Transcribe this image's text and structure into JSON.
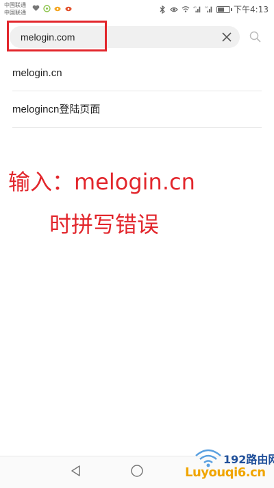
{
  "status_bar": {
    "carrier_1": "中国联通",
    "carrier_2": "中国联通",
    "signal_1_label": "4G",
    "signal_2_label": "2G",
    "time": "下午4:13"
  },
  "search": {
    "value": "melogin.com",
    "clear_icon": "close-icon",
    "search_icon": "search-icon"
  },
  "suggestions": [
    {
      "label": "melogin.cn"
    },
    {
      "label": "melogincn登陆页面"
    }
  ],
  "annotation": {
    "line1": "输入：melogin.cn",
    "line2": "时拼写错误",
    "color": "#e2262c"
  },
  "nav": {
    "back_icon": "back-triangle-icon",
    "home_icon": "home-circle-icon"
  },
  "watermark": {
    "title": "192路由网",
    "url": "Luyouqi6.cn"
  }
}
